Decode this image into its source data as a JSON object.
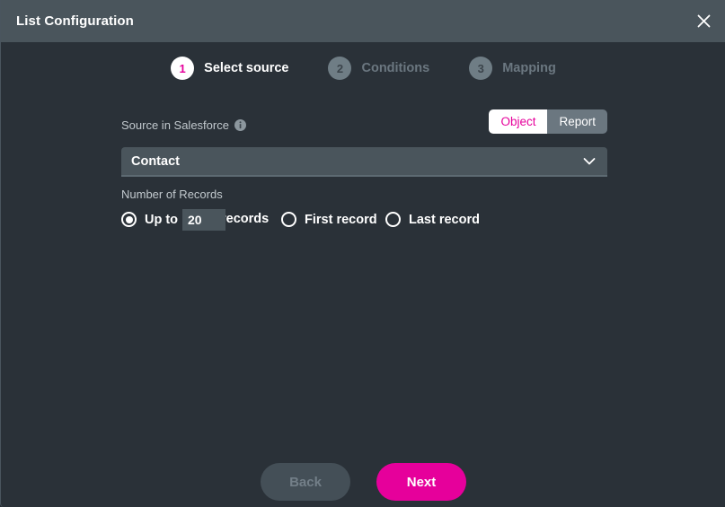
{
  "window": {
    "title": "List Configuration",
    "close_icon": "close-icon"
  },
  "stepper": {
    "steps": [
      {
        "number": "1",
        "label": "Select source",
        "state": "active"
      },
      {
        "number": "2",
        "label": "Conditions",
        "state": "inactive"
      },
      {
        "number": "3",
        "label": "Mapping",
        "state": "inactive"
      }
    ]
  },
  "form": {
    "source": {
      "label": "Source in Salesforce",
      "info_icon": "info-icon",
      "toggle": {
        "options": [
          "Object",
          "Report"
        ],
        "selected": "Object"
      },
      "select": {
        "value": "Contact",
        "chevron_icon": "chevron-down-icon"
      }
    },
    "records": {
      "label": "Number of Records",
      "selected": "Up to",
      "up_to": {
        "label": "Up to",
        "value": "20",
        "suffix": "records"
      },
      "first": {
        "label": "First record"
      },
      "last": {
        "label": "Last record"
      }
    }
  },
  "footer": {
    "back_label": "Back",
    "next_label": "Next"
  },
  "colors": {
    "accent": "#e6009b",
    "header_bg": "#4a555c",
    "dialog_bg": "#2a3138",
    "field_bg": "#4a555c"
  }
}
